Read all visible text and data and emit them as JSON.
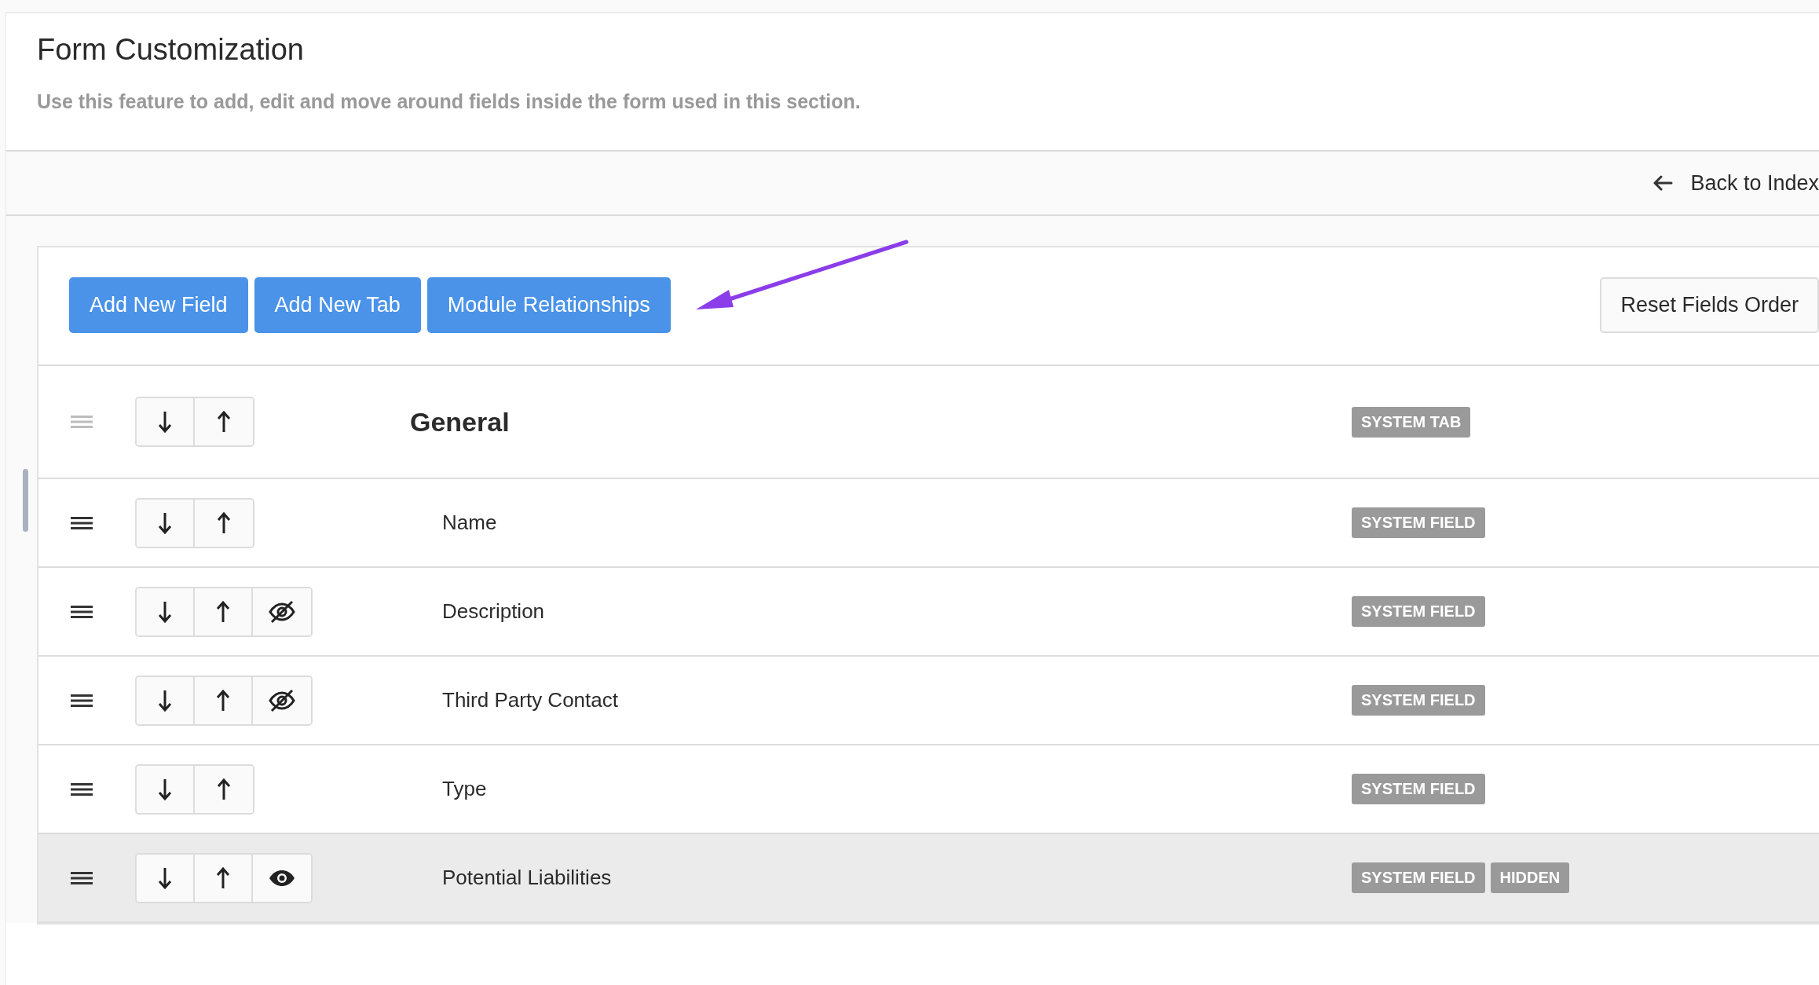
{
  "header": {
    "title": "Form Customization",
    "description": "Use this feature to add, edit and move around fields inside the form used in this section."
  },
  "toolbar": {
    "back_link": "Back to Index"
  },
  "actions": [
    "Add New Field",
    "Add New Tab",
    "Module Relationships"
  ],
  "reset_button": "Reset Fields Order",
  "rows": [
    {
      "kind": "tab",
      "label": "General",
      "drag_enabled": false,
      "can_hide": false,
      "hidden": false,
      "badges": [
        "SYSTEM TAB"
      ]
    },
    {
      "kind": "field",
      "label": "Name",
      "drag_enabled": true,
      "can_hide": false,
      "hidden": false,
      "badges": [
        "SYSTEM FIELD"
      ]
    },
    {
      "kind": "field",
      "label": "Description",
      "drag_enabled": true,
      "can_hide": true,
      "hidden": false,
      "badges": [
        "SYSTEM FIELD"
      ]
    },
    {
      "kind": "field",
      "label": "Third Party Contact",
      "drag_enabled": true,
      "can_hide": true,
      "hidden": false,
      "badges": [
        "SYSTEM FIELD"
      ]
    },
    {
      "kind": "field",
      "label": "Type",
      "drag_enabled": true,
      "can_hide": false,
      "hidden": false,
      "badges": [
        "SYSTEM FIELD"
      ]
    },
    {
      "kind": "field",
      "label": "Potential Liabilities",
      "drag_enabled": true,
      "can_hide": true,
      "hidden": true,
      "badges": [
        "SYSTEM FIELD",
        "HIDDEN"
      ]
    }
  ]
}
